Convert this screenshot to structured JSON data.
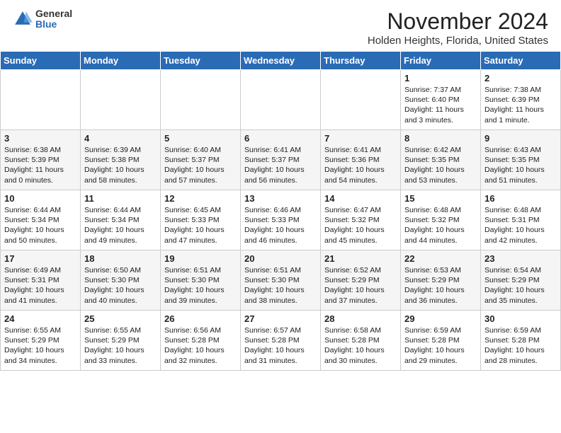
{
  "header": {
    "logo_general": "General",
    "logo_blue": "Blue",
    "month_title": "November 2024",
    "location": "Holden Heights, Florida, United States"
  },
  "days_of_week": [
    "Sunday",
    "Monday",
    "Tuesday",
    "Wednesday",
    "Thursday",
    "Friday",
    "Saturday"
  ],
  "weeks": [
    [
      {
        "day": "",
        "sunrise": "",
        "sunset": "",
        "daylight": ""
      },
      {
        "day": "",
        "sunrise": "",
        "sunset": "",
        "daylight": ""
      },
      {
        "day": "",
        "sunrise": "",
        "sunset": "",
        "daylight": ""
      },
      {
        "day": "",
        "sunrise": "",
        "sunset": "",
        "daylight": ""
      },
      {
        "day": "",
        "sunrise": "",
        "sunset": "",
        "daylight": ""
      },
      {
        "day": "1",
        "sunrise": "Sunrise: 7:37 AM",
        "sunset": "Sunset: 6:40 PM",
        "daylight": "Daylight: 11 hours and 3 minutes."
      },
      {
        "day": "2",
        "sunrise": "Sunrise: 7:38 AM",
        "sunset": "Sunset: 6:39 PM",
        "daylight": "Daylight: 11 hours and 1 minute."
      }
    ],
    [
      {
        "day": "3",
        "sunrise": "Sunrise: 6:38 AM",
        "sunset": "Sunset: 5:39 PM",
        "daylight": "Daylight: 11 hours and 0 minutes."
      },
      {
        "day": "4",
        "sunrise": "Sunrise: 6:39 AM",
        "sunset": "Sunset: 5:38 PM",
        "daylight": "Daylight: 10 hours and 58 minutes."
      },
      {
        "day": "5",
        "sunrise": "Sunrise: 6:40 AM",
        "sunset": "Sunset: 5:37 PM",
        "daylight": "Daylight: 10 hours and 57 minutes."
      },
      {
        "day": "6",
        "sunrise": "Sunrise: 6:41 AM",
        "sunset": "Sunset: 5:37 PM",
        "daylight": "Daylight: 10 hours and 56 minutes."
      },
      {
        "day": "7",
        "sunrise": "Sunrise: 6:41 AM",
        "sunset": "Sunset: 5:36 PM",
        "daylight": "Daylight: 10 hours and 54 minutes."
      },
      {
        "day": "8",
        "sunrise": "Sunrise: 6:42 AM",
        "sunset": "Sunset: 5:35 PM",
        "daylight": "Daylight: 10 hours and 53 minutes."
      },
      {
        "day": "9",
        "sunrise": "Sunrise: 6:43 AM",
        "sunset": "Sunset: 5:35 PM",
        "daylight": "Daylight: 10 hours and 51 minutes."
      }
    ],
    [
      {
        "day": "10",
        "sunrise": "Sunrise: 6:44 AM",
        "sunset": "Sunset: 5:34 PM",
        "daylight": "Daylight: 10 hours and 50 minutes."
      },
      {
        "day": "11",
        "sunrise": "Sunrise: 6:44 AM",
        "sunset": "Sunset: 5:34 PM",
        "daylight": "Daylight: 10 hours and 49 minutes."
      },
      {
        "day": "12",
        "sunrise": "Sunrise: 6:45 AM",
        "sunset": "Sunset: 5:33 PM",
        "daylight": "Daylight: 10 hours and 47 minutes."
      },
      {
        "day": "13",
        "sunrise": "Sunrise: 6:46 AM",
        "sunset": "Sunset: 5:33 PM",
        "daylight": "Daylight: 10 hours and 46 minutes."
      },
      {
        "day": "14",
        "sunrise": "Sunrise: 6:47 AM",
        "sunset": "Sunset: 5:32 PM",
        "daylight": "Daylight: 10 hours and 45 minutes."
      },
      {
        "day": "15",
        "sunrise": "Sunrise: 6:48 AM",
        "sunset": "Sunset: 5:32 PM",
        "daylight": "Daylight: 10 hours and 44 minutes."
      },
      {
        "day": "16",
        "sunrise": "Sunrise: 6:48 AM",
        "sunset": "Sunset: 5:31 PM",
        "daylight": "Daylight: 10 hours and 42 minutes."
      }
    ],
    [
      {
        "day": "17",
        "sunrise": "Sunrise: 6:49 AM",
        "sunset": "Sunset: 5:31 PM",
        "daylight": "Daylight: 10 hours and 41 minutes."
      },
      {
        "day": "18",
        "sunrise": "Sunrise: 6:50 AM",
        "sunset": "Sunset: 5:30 PM",
        "daylight": "Daylight: 10 hours and 40 minutes."
      },
      {
        "day": "19",
        "sunrise": "Sunrise: 6:51 AM",
        "sunset": "Sunset: 5:30 PM",
        "daylight": "Daylight: 10 hours and 39 minutes."
      },
      {
        "day": "20",
        "sunrise": "Sunrise: 6:51 AM",
        "sunset": "Sunset: 5:30 PM",
        "daylight": "Daylight: 10 hours and 38 minutes."
      },
      {
        "day": "21",
        "sunrise": "Sunrise: 6:52 AM",
        "sunset": "Sunset: 5:29 PM",
        "daylight": "Daylight: 10 hours and 37 minutes."
      },
      {
        "day": "22",
        "sunrise": "Sunrise: 6:53 AM",
        "sunset": "Sunset: 5:29 PM",
        "daylight": "Daylight: 10 hours and 36 minutes."
      },
      {
        "day": "23",
        "sunrise": "Sunrise: 6:54 AM",
        "sunset": "Sunset: 5:29 PM",
        "daylight": "Daylight: 10 hours and 35 minutes."
      }
    ],
    [
      {
        "day": "24",
        "sunrise": "Sunrise: 6:55 AM",
        "sunset": "Sunset: 5:29 PM",
        "daylight": "Daylight: 10 hours and 34 minutes."
      },
      {
        "day": "25",
        "sunrise": "Sunrise: 6:55 AM",
        "sunset": "Sunset: 5:29 PM",
        "daylight": "Daylight: 10 hours and 33 minutes."
      },
      {
        "day": "26",
        "sunrise": "Sunrise: 6:56 AM",
        "sunset": "Sunset: 5:28 PM",
        "daylight": "Daylight: 10 hours and 32 minutes."
      },
      {
        "day": "27",
        "sunrise": "Sunrise: 6:57 AM",
        "sunset": "Sunset: 5:28 PM",
        "daylight": "Daylight: 10 hours and 31 minutes."
      },
      {
        "day": "28",
        "sunrise": "Sunrise: 6:58 AM",
        "sunset": "Sunset: 5:28 PM",
        "daylight": "Daylight: 10 hours and 30 minutes."
      },
      {
        "day": "29",
        "sunrise": "Sunrise: 6:59 AM",
        "sunset": "Sunset: 5:28 PM",
        "daylight": "Daylight: 10 hours and 29 minutes."
      },
      {
        "day": "30",
        "sunrise": "Sunrise: 6:59 AM",
        "sunset": "Sunset: 5:28 PM",
        "daylight": "Daylight: 10 hours and 28 minutes."
      }
    ]
  ]
}
